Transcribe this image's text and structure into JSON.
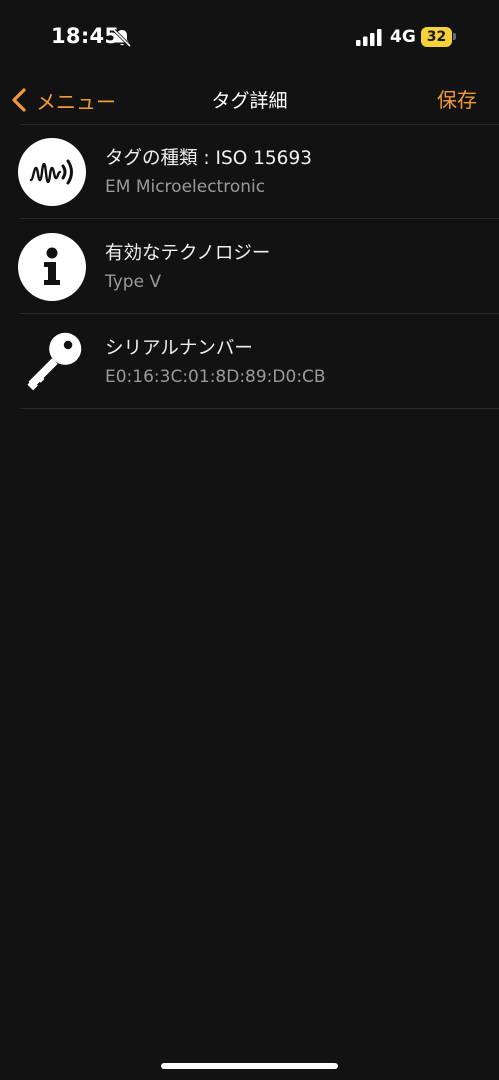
{
  "status_bar": {
    "time": "18:45",
    "network": "4G",
    "battery": "32",
    "icons": [
      "bell-slash-icon",
      "signal-icon"
    ]
  },
  "nav": {
    "back_label": "メニュー",
    "title": "タグ詳細",
    "save_label": "保存",
    "back_icon": "chevron-left-icon"
  },
  "colors": {
    "background": "#121212",
    "accent": "#f39a35",
    "battery": "#f6d23a",
    "secondary_text": "#9a9a9a"
  },
  "rows": [
    {
      "icon": "nfc-tag-icon",
      "title": "タグの種類 : ISO 15693",
      "subtitle": "EM Microelectronic"
    },
    {
      "icon": "info-icon",
      "title": "有効なテクノロジー",
      "subtitle": "Type V"
    },
    {
      "icon": "key-icon",
      "title": "シリアルナンバー",
      "subtitle": "E0:16:3C:01:8D:89:D0:CB"
    }
  ]
}
